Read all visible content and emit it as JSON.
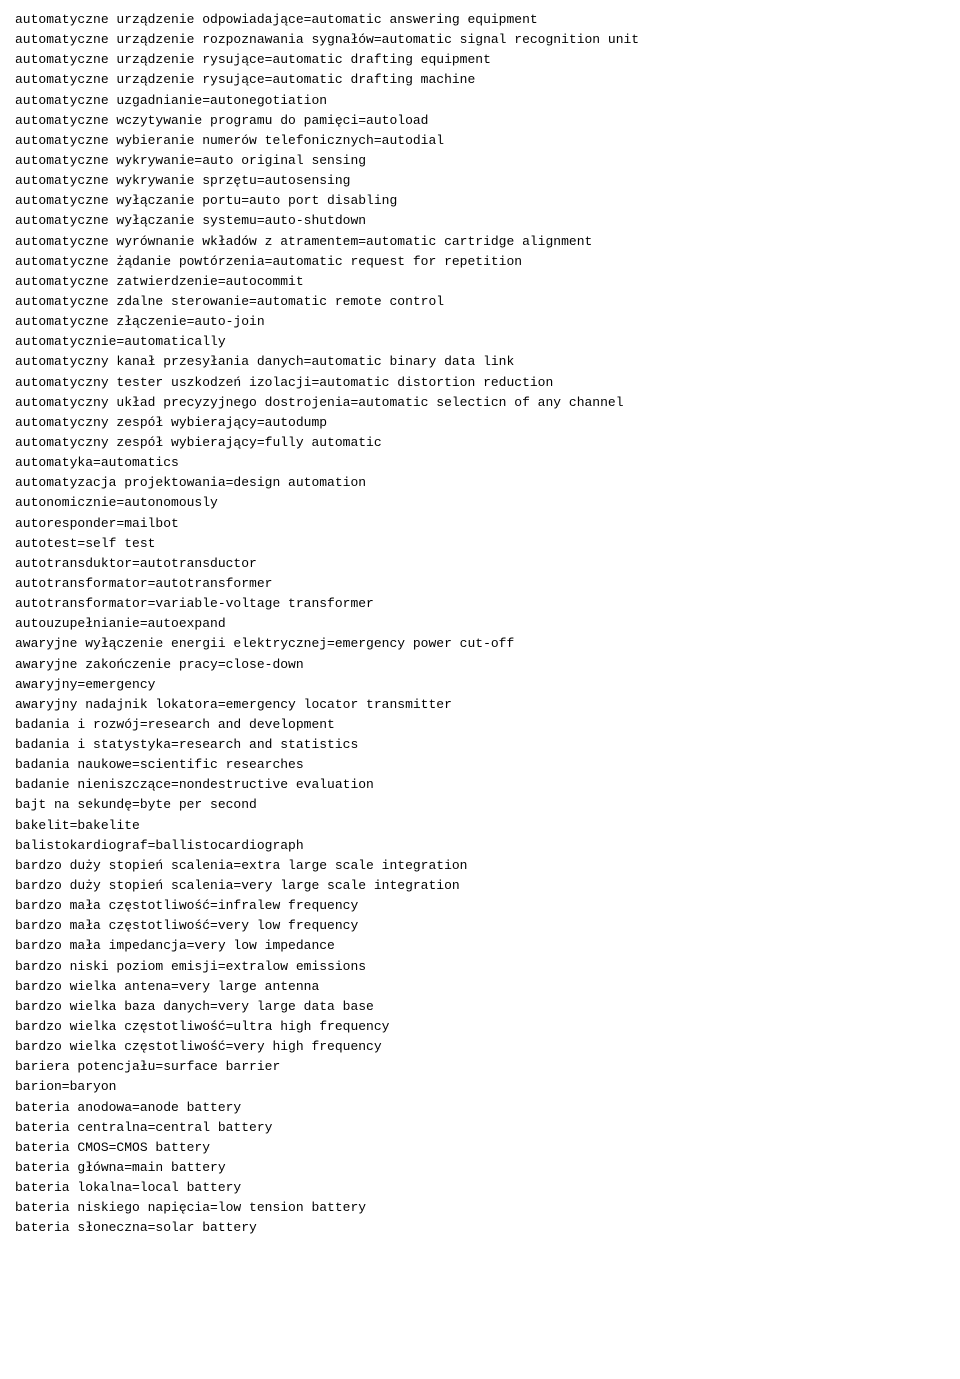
{
  "content": {
    "lines": [
      "automatyczne urządzenie odpowiadające=automatic answering equipment",
      "automatyczne urządzenie rozpoznawania sygnałów=automatic signal recognition unit",
      "automatyczne urządzenie rysujące=automatic drafting equipment",
      "automatyczne urządzenie rysujące=automatic drafting machine",
      "automatyczne uzgadnianie=autonegotiation",
      "automatyczne wczytywanie programu do pamięci=autoload",
      "automatyczne wybieranie numerów telefonicznych=autodial",
      "automatyczne wykrywanie=auto original sensing",
      "automatyczne wykrywanie sprzętu=autosensing",
      "automatyczne wyłączanie portu=auto port disabling",
      "automatyczne wyłączanie systemu=auto-shutdown",
      "automatyczne wyrównanie wkładów z atramentem=automatic cartridge alignment",
      "automatyczne żądanie powtórzenia=automatic request for repetition",
      "automatyczne zatwierdzenie=autocommit",
      "automatyczne zdalne sterowanie=automatic remote control",
      "automatyczne złączenie=auto-join",
      "automatycznie=automatically",
      "automatyczny kanał przesyłania danych=automatic binary data link",
      "automatyczny tester uszkodzeń izolacji=automatic distortion reduction",
      "automatyczny układ precyzyjnego dostrojenia=automatic selecticn of any channel",
      "automatyczny zespół wybierający=autodump",
      "automatyczny zespół wybierający=fully automatic",
      "automatyka=automatics",
      "automatyzacja projektowania=design automation",
      "autonomicznie=autonomously",
      "autoresponder=mailbot",
      "autotest=self test",
      "autotransduktor=autotransductor",
      "autotransformator=autotransformer",
      "autotransformator=variable-voltage transformer",
      "autouzupełnianie=autoexpand",
      "awaryjne wyłączenie energii elektrycznej=emergency power cut-off",
      "awaryjne zakończenie pracy=close-down",
      "awaryjny=emergency",
      "awaryjny nadajnik lokatora=emergency locator transmitter",
      "badania i rozwój=research and development",
      "badania i statystyka=research and statistics",
      "badania naukowe=scientific researches",
      "badanie nieniszczące=nondestructive evaluation",
      "bajt na sekundę=byte per second",
      "bakelit=bakelite",
      "balistokardiograf=ballistocardiograph",
      "bardzo duży stopień scalenia=extra large scale integration",
      "bardzo duży stopień scalenia=very large scale integration",
      "bardzo mała częstotliwość=infralew frequency",
      "bardzo mała częstotliwość=very low frequency",
      "bardzo mała impedancja=very low impedance",
      "bardzo niski poziom emisji=extralow emissions",
      "bardzo wielka antena=very large antenna",
      "bardzo wielka baza danych=very large data base",
      "bardzo wielka częstotliwość=ultra high frequency",
      "bardzo wielka częstotliwość=very high frequency",
      "bariera potencjału=surface barrier",
      "barion=baryon",
      "bateria anodowa=anode battery",
      "bateria centralna=central battery",
      "bateria CMOS=CMOS battery",
      "bateria główna=main battery",
      "bateria lokalna=local battery",
      "bateria niskiego napięcia=low tension battery",
      "bateria słoneczna=solar battery"
    ]
  }
}
